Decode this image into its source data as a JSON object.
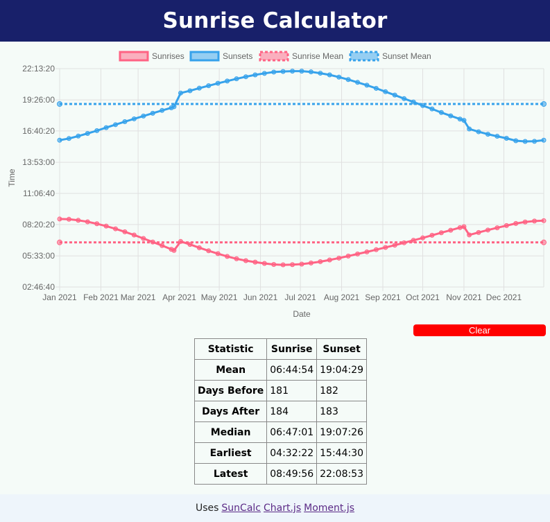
{
  "header": {
    "title": "Sunrise Calculator"
  },
  "chart_data": {
    "type": "line",
    "xlabel": "Date",
    "ylabel": "Time",
    "y_unit": "HH:MM:SS",
    "ylim": [
      "02:46:40",
      "22:13:20"
    ],
    "y_ticks": [
      "22:13:20",
      "19:26:00",
      "16:40:20",
      "13:53:00",
      "11:06:40",
      "08:20:20",
      "05:33:00",
      "02:46:40"
    ],
    "x_ticks": [
      "Jan 2021",
      "Feb 2021",
      "Mar 2021",
      "Apr 2021",
      "May 2021",
      "Jun 2021",
      "Jul 2021",
      "Aug 2021",
      "Sep 2021",
      "Oct 2021",
      "Nov 2021",
      "Dec 2021"
    ],
    "xlim": [
      "2021-01-01",
      "2021-12-31"
    ],
    "grid": true,
    "legend_position": "top",
    "colors": {
      "sunrise": "#ff6384",
      "sunset": "#36a2eb"
    },
    "series": [
      {
        "name": "Sunrises",
        "x": [
          "2021-01-01",
          "2021-01-08",
          "2021-01-15",
          "2021-01-22",
          "2021-01-29",
          "2021-02-05",
          "2021-02-12",
          "2021-02-19",
          "2021-02-26",
          "2021-03-05",
          "2021-03-12",
          "2021-03-19",
          "2021-03-26",
          "2021-03-28",
          "2021-04-02",
          "2021-04-09",
          "2021-04-16",
          "2021-04-23",
          "2021-04-30",
          "2021-05-07",
          "2021-05-14",
          "2021-05-21",
          "2021-05-28",
          "2021-06-04",
          "2021-06-11",
          "2021-06-18",
          "2021-06-25",
          "2021-07-02",
          "2021-07-09",
          "2021-07-16",
          "2021-07-23",
          "2021-07-30",
          "2021-08-06",
          "2021-08-13",
          "2021-08-20",
          "2021-08-27",
          "2021-09-03",
          "2021-09-10",
          "2021-09-17",
          "2021-09-24",
          "2021-10-01",
          "2021-10-08",
          "2021-10-15",
          "2021-10-22",
          "2021-10-29",
          "2021-11-01",
          "2021-11-05",
          "2021-11-12",
          "2021-11-19",
          "2021-11-26",
          "2021-12-03",
          "2021-12-10",
          "2021-12-17",
          "2021-12-24",
          "2021-12-31"
        ],
        "y": [
          "08:49:56",
          "08:48:30",
          "08:43:00",
          "08:35:00",
          "08:24:30",
          "08:12:00",
          "07:57:30",
          "07:41:30",
          "07:24:30",
          "07:06:00",
          "06:47:00",
          "06:28:00",
          "06:08:00",
          "06:02:00",
          "06:50:00",
          "06:34:00",
          "06:16:30",
          "06:00:00",
          "05:45:00",
          "05:30:00",
          "05:17:30",
          "05:07:30",
          "04:59:30",
          "04:52:30",
          "04:47:00",
          "04:45:00",
          "04:46:00",
          "04:49:00",
          "04:55:00",
          "05:02:00",
          "05:11:00",
          "05:21:00",
          "05:32:00",
          "05:43:00",
          "05:54:00",
          "06:06:00",
          "06:18:00",
          "06:30:00",
          "06:43:00",
          "06:56:00",
          "07:09:00",
          "07:23:00",
          "07:36:30",
          "07:50:00",
          "08:04:00",
          "08:09:00",
          "07:25:00",
          "07:38:00",
          "07:51:00",
          "08:03:00",
          "08:15:00",
          "08:26:00",
          "08:34:00",
          "08:39:00",
          "08:41:00"
        ]
      },
      {
        "name": "Sunsets",
        "x": [
          "2021-01-01",
          "2021-01-08",
          "2021-01-15",
          "2021-01-22",
          "2021-01-29",
          "2021-02-05",
          "2021-02-12",
          "2021-02-19",
          "2021-02-26",
          "2021-03-05",
          "2021-03-12",
          "2021-03-19",
          "2021-03-26",
          "2021-03-28",
          "2021-04-02",
          "2021-04-09",
          "2021-04-16",
          "2021-04-23",
          "2021-04-30",
          "2021-05-07",
          "2021-05-14",
          "2021-05-21",
          "2021-05-28",
          "2021-06-04",
          "2021-06-11",
          "2021-06-18",
          "2021-06-25",
          "2021-07-02",
          "2021-07-09",
          "2021-07-16",
          "2021-07-23",
          "2021-07-30",
          "2021-08-06",
          "2021-08-13",
          "2021-08-20",
          "2021-08-27",
          "2021-09-03",
          "2021-09-10",
          "2021-09-17",
          "2021-09-24",
          "2021-10-01",
          "2021-10-08",
          "2021-10-15",
          "2021-10-22",
          "2021-10-29",
          "2021-11-01",
          "2021-11-05",
          "2021-11-12",
          "2021-11-19",
          "2021-11-26",
          "2021-12-03",
          "2021-12-10",
          "2021-12-17",
          "2021-12-24",
          "2021-12-31"
        ],
        "y": [
          "15:51:00",
          "16:00:00",
          "16:13:00",
          "16:27:00",
          "16:42:00",
          "16:58:00",
          "17:14:00",
          "17:30:00",
          "17:45:00",
          "18:00:00",
          "18:15:00",
          "18:30:00",
          "18:44:00",
          "18:50:00",
          "20:03:00",
          "20:15:00",
          "20:29:00",
          "20:42:00",
          "20:55:00",
          "21:07:00",
          "21:19:00",
          "21:30:00",
          "21:40:00",
          "21:48:00",
          "21:55:00",
          "21:58:00",
          "22:00:00",
          "22:00:00",
          "21:56:00",
          "21:49:00",
          "21:40:00",
          "21:28:00",
          "21:15:00",
          "21:00:00",
          "20:45:00",
          "20:28:00",
          "20:10:00",
          "19:52:00",
          "19:33:00",
          "19:15:00",
          "18:56:00",
          "18:38:00",
          "18:19:00",
          "18:01:00",
          "17:44:00",
          "17:37:00",
          "16:51:00",
          "16:36:00",
          "16:23:00",
          "16:12:00",
          "16:01:00",
          "15:48:00",
          "15:44:30",
          "15:45:00",
          "15:51:00"
        ]
      },
      {
        "name": "Sunrise Mean",
        "value": "06:44:54"
      },
      {
        "name": "Sunset Mean",
        "value": "19:04:29"
      }
    ]
  },
  "controls": {
    "clear_label": "Clear"
  },
  "stats": {
    "headers": [
      "Statistic",
      "Sunrise",
      "Sunset"
    ],
    "rows": [
      {
        "label": "Mean",
        "sunrise": "06:44:54",
        "sunset": "19:04:29"
      },
      {
        "label": "Days Before",
        "sunrise": "181",
        "sunset": "182"
      },
      {
        "label": "Days After",
        "sunrise": "184",
        "sunset": "183"
      },
      {
        "label": "Median",
        "sunrise": "06:47:01",
        "sunset": "19:07:26"
      },
      {
        "label": "Earliest",
        "sunrise": "04:32:22",
        "sunset": "15:44:30"
      },
      {
        "label": "Latest",
        "sunrise": "08:49:56",
        "sunset": "22:08:53"
      }
    ]
  },
  "footer": {
    "prefix": "Uses",
    "links": [
      "SunCalc",
      "Chart.js",
      "Moment.js"
    ]
  }
}
